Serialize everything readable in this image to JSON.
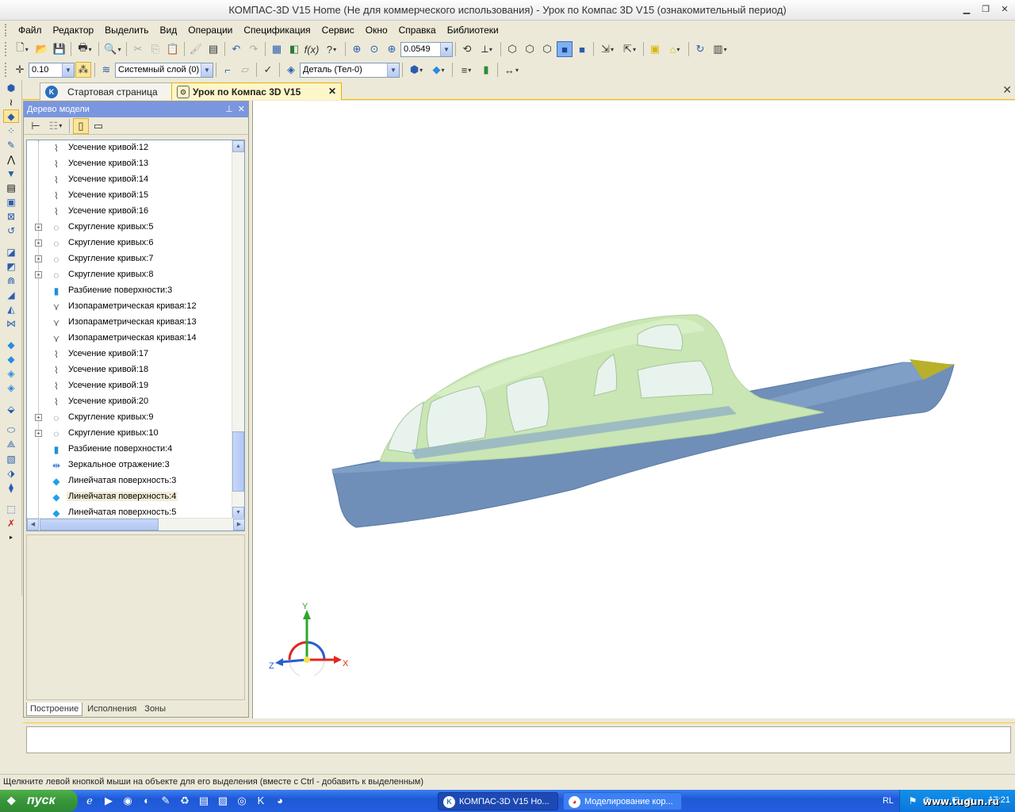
{
  "window": {
    "title": "КОМПАС-3D V15 Home (Не для коммерческого использования) - Урок по Компас 3D V15 (ознакомительный период)"
  },
  "menu": [
    "Файл",
    "Редактор",
    "Выделить",
    "Вид",
    "Операции",
    "Спецификация",
    "Сервис",
    "Окно",
    "Справка",
    "Библиотеки"
  ],
  "toolbar1": {
    "zoom_value": "0.0549"
  },
  "toolbar2": {
    "step_value": "0.10",
    "layer_value": "Системный слой (0)",
    "part_value": "Деталь (Тел-0)"
  },
  "doc_tabs": {
    "start_label": "Стартовая страница",
    "lesson_label": "Урок по Компас 3D V15"
  },
  "model_tree": {
    "header": "Дерево модели",
    "items": [
      {
        "label": "Усечение кривой:12",
        "expandable": false,
        "icon": "curve-trim-icon"
      },
      {
        "label": "Усечение кривой:13",
        "expandable": false,
        "icon": "curve-trim-icon"
      },
      {
        "label": "Усечение кривой:14",
        "expandable": false,
        "icon": "curve-trim-icon"
      },
      {
        "label": "Усечение кривой:15",
        "expandable": false,
        "icon": "curve-trim-icon"
      },
      {
        "label": "Усечение кривой:16",
        "expandable": false,
        "icon": "curve-trim-icon"
      },
      {
        "label": "Скругление кривых:5",
        "expandable": true,
        "icon": "curve-fillet-icon"
      },
      {
        "label": "Скругление кривых:6",
        "expandable": true,
        "icon": "curve-fillet-icon"
      },
      {
        "label": "Скругление кривых:7",
        "expandable": true,
        "icon": "curve-fillet-icon"
      },
      {
        "label": "Скругление кривых:8",
        "expandable": true,
        "icon": "curve-fillet-icon"
      },
      {
        "label": "Разбиение поверхности:3",
        "expandable": false,
        "icon": "surface-split-icon"
      },
      {
        "label": "Изопараметрическая кривая:12",
        "expandable": false,
        "icon": "isoparametric-curve-icon"
      },
      {
        "label": "Изопараметрическая кривая:13",
        "expandable": false,
        "icon": "isoparametric-curve-icon"
      },
      {
        "label": "Изопараметрическая кривая:14",
        "expandable": false,
        "icon": "isoparametric-curve-icon"
      },
      {
        "label": "Усечение кривой:17",
        "expandable": false,
        "icon": "curve-trim-icon"
      },
      {
        "label": "Усечение кривой:18",
        "expandable": false,
        "icon": "curve-trim-icon"
      },
      {
        "label": "Усечение кривой:19",
        "expandable": false,
        "icon": "curve-trim-icon"
      },
      {
        "label": "Усечение кривой:20",
        "expandable": false,
        "icon": "curve-trim-icon"
      },
      {
        "label": "Скругление кривых:9",
        "expandable": true,
        "icon": "curve-fillet-icon"
      },
      {
        "label": "Скругление кривых:10",
        "expandable": true,
        "icon": "curve-fillet-icon"
      },
      {
        "label": "Разбиение поверхности:4",
        "expandable": false,
        "icon": "surface-split-icon"
      },
      {
        "label": "Зеркальное отражение:3",
        "expandable": false,
        "icon": "mirror-icon"
      },
      {
        "label": "Линейчатая поверхность:3",
        "expandable": false,
        "icon": "ruled-surface-icon"
      },
      {
        "label": "Линейчатая поверхность:4",
        "expandable": false,
        "icon": "ruled-surface-icon",
        "selected": true
      },
      {
        "label": "Линейчатая поверхность:5",
        "expandable": false,
        "icon": "ruled-surface-icon"
      }
    ],
    "bottom_tabs": [
      "Построение",
      "Исполнения",
      "Зоны"
    ]
  },
  "axes": {
    "x": "X",
    "y": "Y",
    "z": "Z"
  },
  "status_text": "Щелкните левой кнопкой мыши на объекте для его выделения (вместе с Ctrl - добавить к выделенным)",
  "taskbar": {
    "start_label": "пуск",
    "task1": "КОМПАС-3D V15 Ho...",
    "task2": "Моделирование кор...",
    "lang": "RL",
    "clock": "17:21",
    "watermark": "www.tugun.ru"
  },
  "colors": {
    "hull": "#6f8fb8",
    "cabin": "#c9e6b4",
    "bow_tip": "#b8b02a",
    "tab_accent": "#ffb400"
  }
}
